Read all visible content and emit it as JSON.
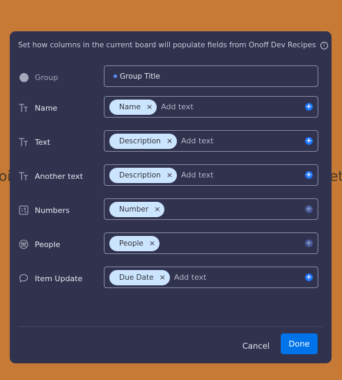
{
  "background": {
    "left_text": "oi",
    "right_text": "eth"
  },
  "modal": {
    "header": "Set how columns in the current board will populate fields from Onoff Dev Recipes",
    "info_icon": "i",
    "group_row": {
      "label": "Group",
      "value": "Group Title"
    },
    "rows": [
      {
        "label": "Name",
        "icon": "text-type-icon",
        "chip": "Name",
        "add_text": "Add text",
        "plus_active": true
      },
      {
        "label": "Text",
        "icon": "text-type-icon",
        "chip": "Description",
        "add_text": "Add text",
        "plus_active": true
      },
      {
        "label": "Another text",
        "icon": "text-type-icon",
        "chip": "Description",
        "add_text": "Add text",
        "plus_active": true
      },
      {
        "label": "Numbers",
        "icon": "numbers-icon",
        "chip": "Number",
        "add_text": "",
        "plus_active": false
      },
      {
        "label": "People",
        "icon": "people-icon",
        "chip": "People",
        "add_text": "",
        "plus_active": false
      },
      {
        "label": "Item Update",
        "icon": "speech-bubble-icon",
        "chip": "Due Date",
        "add_text": "Add text",
        "plus_active": true
      }
    ],
    "cancel_label": "Cancel",
    "done_label": "Done"
  },
  "colors": {
    "page_background": "#c67a35",
    "modal_background": "#30324e",
    "chip_background": "#cce5ff",
    "primary": "#0073ea"
  }
}
